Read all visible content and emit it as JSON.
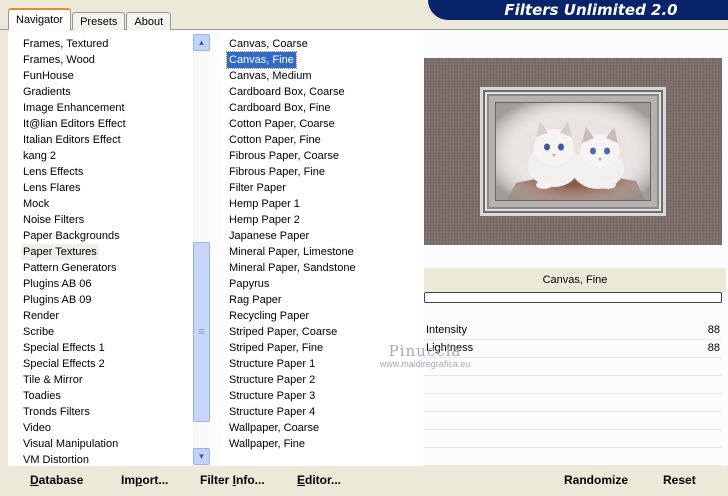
{
  "banner": {
    "title": "Filters Unlimited 2.0"
  },
  "tabs": [
    {
      "label": "Navigator",
      "active": true
    },
    {
      "label": "Presets",
      "active": false
    },
    {
      "label": "About",
      "active": false
    }
  ],
  "categories": {
    "items": [
      "Frames, Textured",
      "Frames, Wood",
      "FunHouse",
      "Gradients",
      "Image Enhancement",
      "It@lian Editors Effect",
      "Italian Editors Effect",
      "kang 2",
      "Lens Effects",
      "Lens Flares",
      "Mock",
      "Noise Filters",
      "Paper Backgrounds",
      "Paper Textures",
      "Pattern Generators",
      "Plugins AB 06",
      "Plugins AB 09",
      "Render",
      "Scribe",
      "Special Effects 1",
      "Special Effects 2",
      "Tile & Mirror",
      "Toadies",
      "Tronds Filters",
      "Video",
      "Visual Manipulation",
      "VM Distortion"
    ],
    "selected": "Paper Textures"
  },
  "filters": {
    "items": [
      "Canvas, Coarse",
      "Canvas, Fine",
      "Canvas, Medium",
      "Cardboard Box, Coarse",
      "Cardboard Box, Fine",
      "Cotton Paper, Coarse",
      "Cotton Paper, Fine",
      "Fibrous Paper, Coarse",
      "Fibrous Paper, Fine",
      "Filter Paper",
      "Hemp Paper 1",
      "Hemp Paper 2",
      "Japanese Paper",
      "Mineral Paper, Limestone",
      "Mineral Paper, Sandstone",
      "Papyrus",
      "Rag Paper",
      "Recycling Paper",
      "Striped Paper, Coarse",
      "Striped Paper, Fine",
      "Structure Paper 1",
      "Structure Paper 2",
      "Structure Paper 3",
      "Structure Paper 4",
      "Wallpaper, Coarse",
      "Wallpaper, Fine"
    ],
    "selected": "Canvas, Fine"
  },
  "preview": {
    "filter_name": "Canvas, Fine",
    "progress": 0
  },
  "sliders": [
    {
      "label": "Intensity",
      "value": "88"
    },
    {
      "label": "Lightness",
      "value": "88"
    }
  ],
  "watermark": {
    "title": "Pinuccia",
    "subtitle": "www.maidiregrafica.eu"
  },
  "buttons": {
    "database": {
      "u": "D",
      "rest": "atabase"
    },
    "import": {
      "pre": "Im",
      "u": "p",
      "rest": "ort..."
    },
    "filter_info": {
      "pre": "Filter ",
      "u": "I",
      "rest": "nfo..."
    },
    "editor": {
      "u": "E",
      "rest": "ditor..."
    },
    "randomize": "Randomize",
    "reset": "Reset"
  },
  "colors": {
    "banner_bg": "#08246b",
    "selection": "#316ac5",
    "tab_accent": "#e68b2c"
  }
}
